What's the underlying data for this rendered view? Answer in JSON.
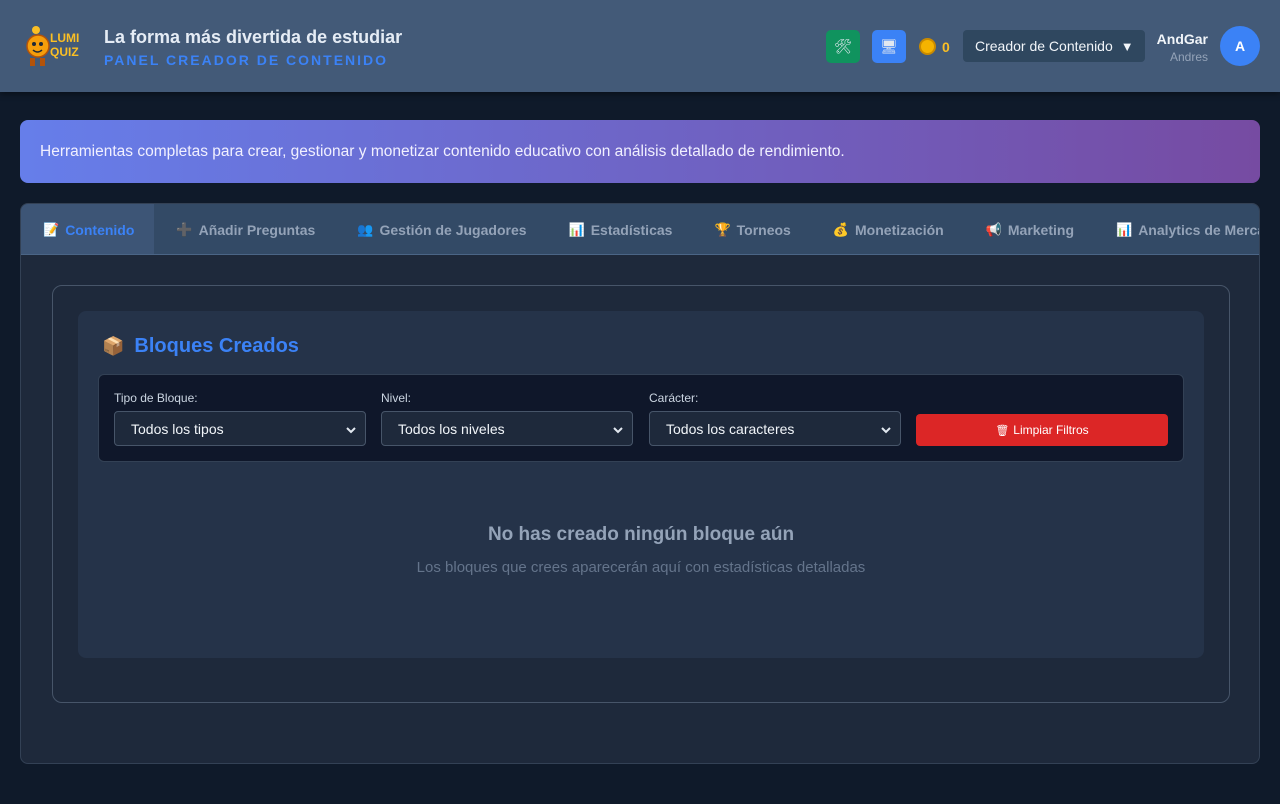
{
  "brand": {
    "logo_line1": "LUMI",
    "logo_line2": "QUIZ",
    "accent": "#3b82f6"
  },
  "header": {
    "title": "La forma más divertida de estudiar",
    "subtitle": "PANEL CREADOR DE CONTENIDO",
    "tools_icon": "🛠",
    "screen_icon": "🖥",
    "coins": "0",
    "role": "Creador de Contenido",
    "role_arrow": "▼",
    "user_name": "AndGar",
    "user_sub": "Andres",
    "avatar_initial": "A"
  },
  "banner": {
    "text": "Herramientas completas para crear, gestionar y monetizar contenido educativo con análisis detallado de rendimiento."
  },
  "tabs": [
    {
      "icon": "📝",
      "label": "Contenido"
    },
    {
      "icon": "➕",
      "label": "Añadir Preguntas"
    },
    {
      "icon": "👥",
      "label": "Gestión de Jugadores"
    },
    {
      "icon": "📊",
      "label": "Estadísticas"
    },
    {
      "icon": "🏆",
      "label": "Torneos"
    },
    {
      "icon": "💰",
      "label": "Monetización"
    },
    {
      "icon": "📢",
      "label": "Marketing"
    },
    {
      "icon": "📊",
      "label": "Analytics de Mercado"
    }
  ],
  "blocks": {
    "icon": "📦",
    "title": "Bloques Creados",
    "filters": {
      "type_label": "Tipo de Bloque:",
      "type_value": "Todos los tipos",
      "level_label": "Nivel:",
      "level_value": "Todos los niveles",
      "char_label": "Carácter:",
      "char_value": "Todos los caracteres",
      "clear_icon": "🗑",
      "clear_label": "Limpiar Filtros"
    },
    "empty_title": "No has creado ningún bloque aún",
    "empty_sub": "Los bloques que crees aparecerán aquí con estadísticas detalladas"
  }
}
